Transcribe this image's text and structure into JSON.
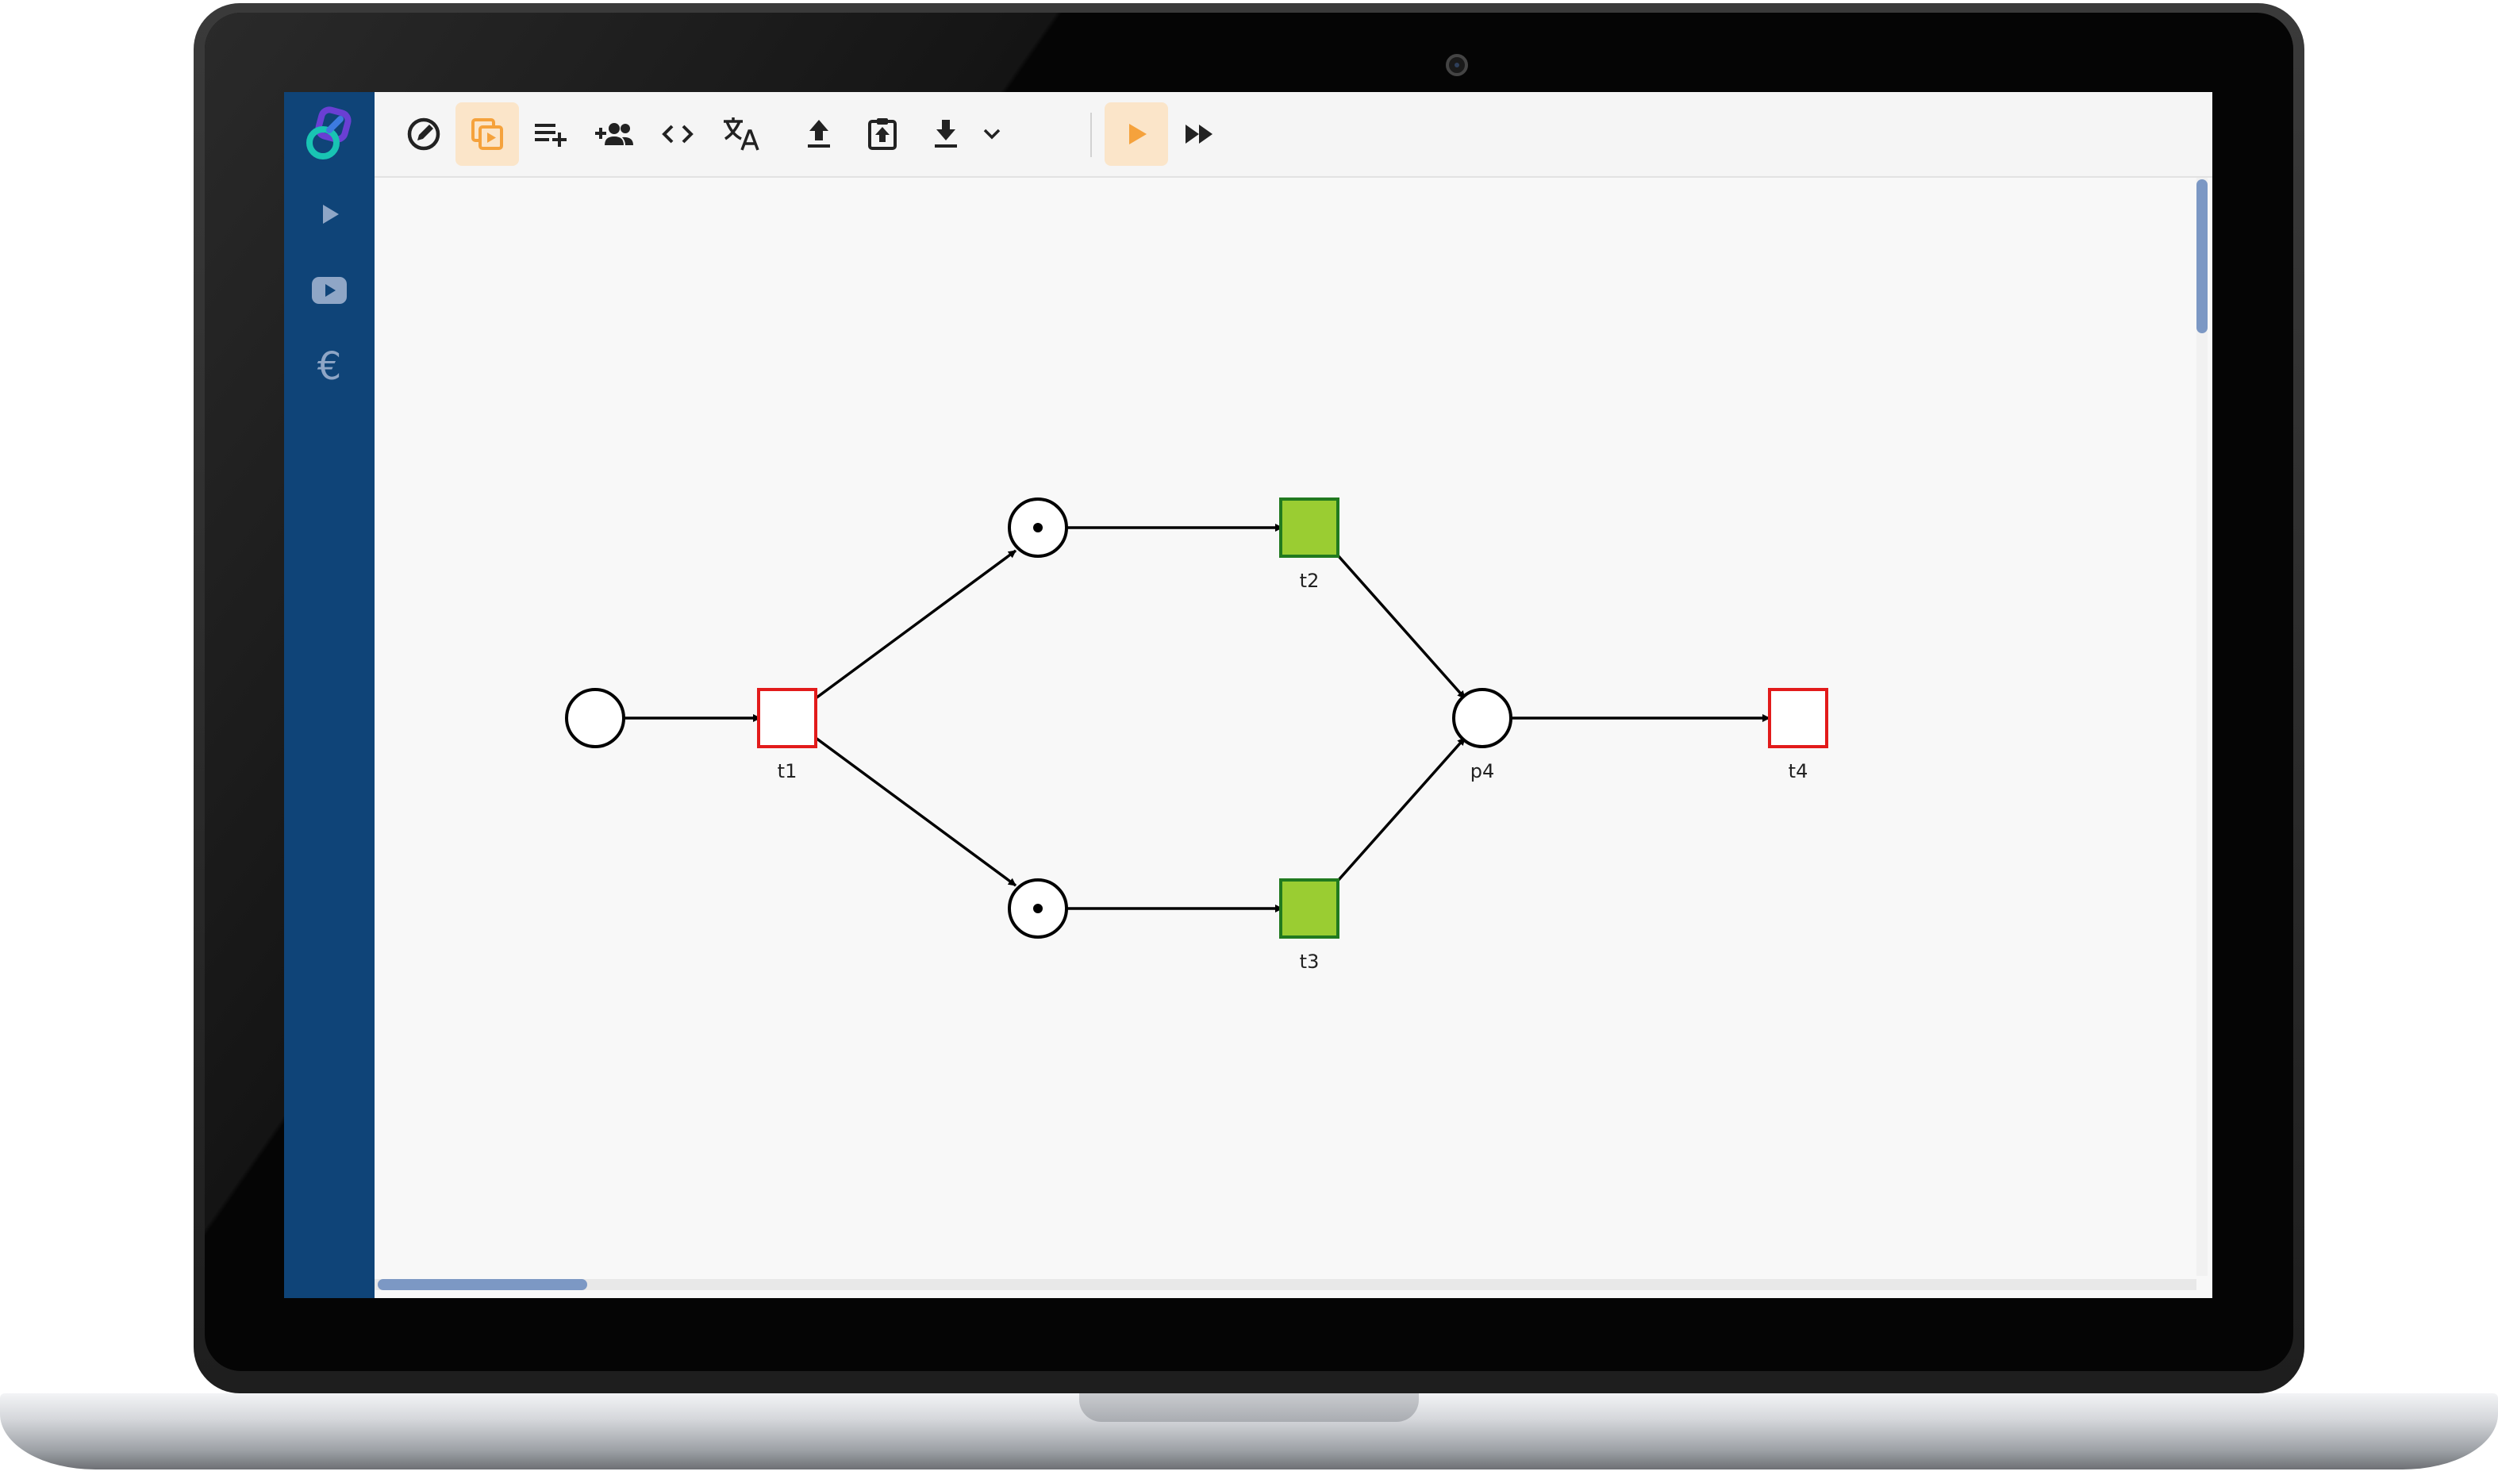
{
  "app": {
    "logo": "linked-rings-logo",
    "brand_colors": {
      "purple": "#6a3fd3",
      "teal": "#19c4b3",
      "sidebar": "#0f4478"
    }
  },
  "sidebar": {
    "items": [
      {
        "icon": "play-icon",
        "label": "Play"
      },
      {
        "icon": "youtube-icon",
        "label": "Video"
      },
      {
        "icon": "euro-icon",
        "label": "€"
      }
    ]
  },
  "toolbar": {
    "tools": [
      {
        "icon": "edit-icon",
        "active": false
      },
      {
        "icon": "simulate-copy-icon",
        "active": true
      },
      {
        "icon": "playlist-add-icon",
        "active": false
      },
      {
        "icon": "add-people-icon",
        "active": false
      },
      {
        "icon": "code-icon",
        "active": false
      },
      {
        "icon": "translate-icon",
        "active": false
      },
      {
        "icon": "upload-icon",
        "active": false
      },
      {
        "icon": "clipboard-upload-icon",
        "active": false
      },
      {
        "icon": "download-icon",
        "active": false
      },
      {
        "icon": "chevron-down-icon",
        "active": false
      },
      {
        "icon": "run-icon",
        "active": true
      },
      {
        "icon": "fast-forward-icon",
        "active": false
      }
    ],
    "active_color": "#f5a23c"
  },
  "petri_net": {
    "places": [
      {
        "id": "p1",
        "label": "",
        "tokens": 0
      },
      {
        "id": "p2",
        "label": "",
        "tokens": 1
      },
      {
        "id": "p3",
        "label": "",
        "tokens": 1
      },
      {
        "id": "p4",
        "label": "p4",
        "tokens": 0
      }
    ],
    "transitions": [
      {
        "id": "t1",
        "label": "t1",
        "enabled": false
      },
      {
        "id": "t2",
        "label": "t2",
        "enabled": true
      },
      {
        "id": "t3",
        "label": "t3",
        "enabled": true
      },
      {
        "id": "t4",
        "label": "t4",
        "enabled": false
      }
    ],
    "arcs": [
      {
        "from": "p1",
        "to": "t1"
      },
      {
        "from": "t1",
        "to": "p2"
      },
      {
        "from": "t1",
        "to": "p3"
      },
      {
        "from": "p2",
        "to": "t2"
      },
      {
        "from": "p3",
        "to": "t3"
      },
      {
        "from": "t2",
        "to": "p4"
      },
      {
        "from": "t3",
        "to": "p4"
      },
      {
        "from": "p4",
        "to": "t4"
      }
    ],
    "colors": {
      "enabled_fill": "#9acd32",
      "enabled_stroke": "#217a1f",
      "disabled_fill": "#ffffff",
      "disabled_stroke": "#e21b1b",
      "place_stroke": "#000000"
    }
  }
}
